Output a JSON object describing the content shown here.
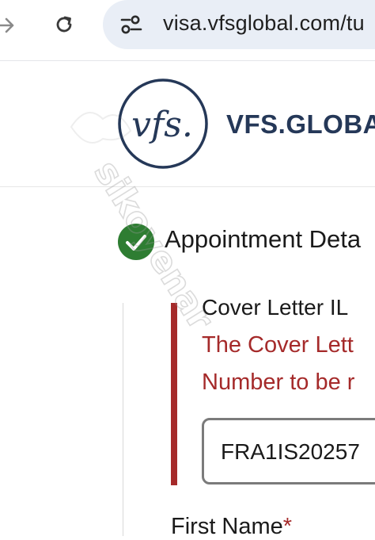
{
  "browser": {
    "url": "visa.vfsglobal.com/tu",
    "icons": [
      "forward-arrow-icon",
      "reload-icon",
      "site-settings-icon"
    ]
  },
  "header": {
    "logo_text": "vfs.",
    "brand": "VFS.GLOBA"
  },
  "step": {
    "title": "Appointment Deta",
    "status_color": "#2e7d32"
  },
  "form": {
    "cover_letter_label": "Cover Letter IL",
    "error_line_1": "The Cover Lett",
    "error_line_2": "Number to be r",
    "cover_letter_value": "FRA1IS20257",
    "first_name_label": "First Name",
    "required_mark": "*",
    "error_color": "#a52a2a"
  },
  "watermark": "sikoyenar"
}
